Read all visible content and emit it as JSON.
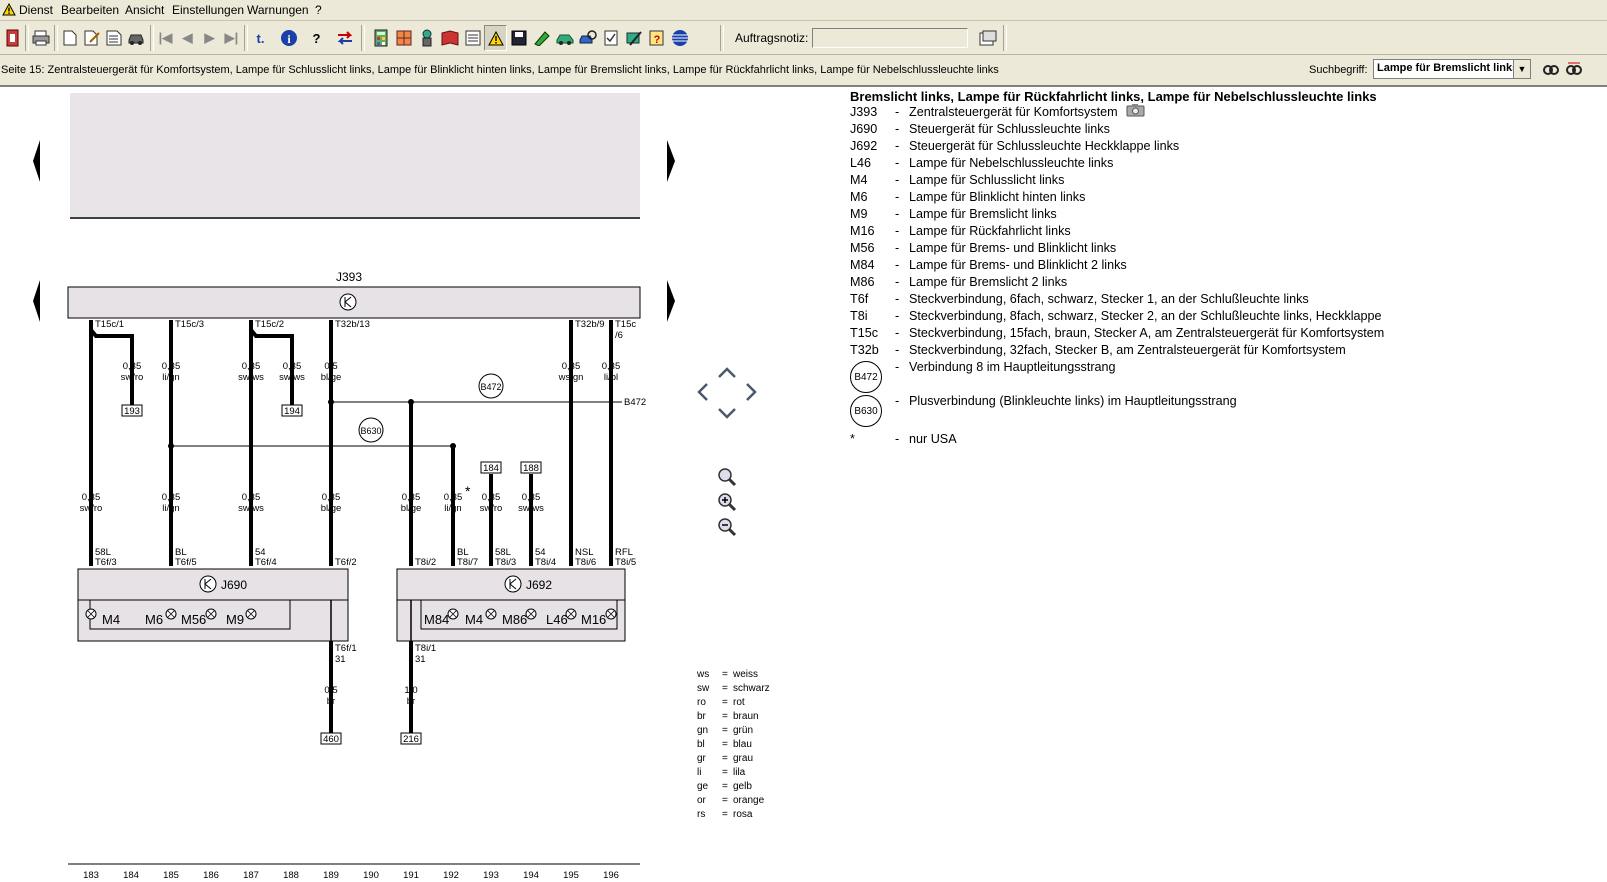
{
  "menu": {
    "items": [
      "Dienst",
      "Bearbeiten",
      "Ansicht",
      "Einstellungen",
      "Warnungen",
      "?"
    ]
  },
  "toolbar": {
    "auftragsnotiz_label": "Auftragsnotiz:",
    "auftragsnotiz_value": ""
  },
  "statusbar": {
    "page_text": "Seite 15: Zentralsteuergerät für Komfortsystem, Lampe für Schlusslicht links, Lampe für Blinklicht hinten links, Lampe für Bremslicht links, Lampe für Rückfahrlicht links, Lampe für Nebelschlussleuchte links",
    "search_label": "Suchbegriff:",
    "search_value": "Lampe für Bremslicht links"
  },
  "legend": {
    "heading": "Bremslicht links, Lampe für Rückfahrlicht links, Lampe für Nebelschlussleuchte links",
    "items": [
      {
        "code": "J393",
        "desc": "Zentralsteuergerät für Komfortsystem"
      },
      {
        "code": "J690",
        "desc": "Steuergerät für Schlussleuchte links"
      },
      {
        "code": "J692",
        "desc": "Steuergerät für Schlussleuchte Heckklappe links"
      },
      {
        "code": "L46",
        "desc": "Lampe für Nebelschlussleuchte links"
      },
      {
        "code": "M4",
        "desc": "Lampe für Schlusslicht links"
      },
      {
        "code": "M6",
        "desc": "Lampe für Blinklicht hinten links"
      },
      {
        "code": "M9",
        "desc": "Lampe für Bremslicht links"
      },
      {
        "code": "M16",
        "desc": "Lampe für Rückfahrlicht links"
      },
      {
        "code": "M56",
        "desc": "Lampe für Brems- und Blinklicht links"
      },
      {
        "code": "M84",
        "desc": "Lampe für Brems- und Blinklicht 2 links"
      },
      {
        "code": "M86",
        "desc": "Lampe für Bremslicht 2 links"
      },
      {
        "code": "T6f",
        "desc": "Steckverbindung, 6fach, schwarz, Stecker 1, an der Schlußleuchte links"
      },
      {
        "code": "T8i",
        "desc": "Steckverbindung, 8fach, schwarz, Stecker 2, an der Schlußleuchte links, Heckklappe"
      },
      {
        "code": "T15c",
        "desc": "Steckverbindung, 15fach, braun, Stecker A, am Zentralsteuergerät für Komfortsystem"
      },
      {
        "code": "T32b",
        "desc": "Steckverbindung, 32fach, Stecker B, am Zentralsteuergerät für Komfortsystem"
      }
    ],
    "circles": [
      {
        "code": "B472",
        "desc": "Verbindung 8 im Hauptleitungsstrang"
      },
      {
        "code": "B630",
        "desc": "Plusverbindung (Blinkleuchte links) im Hauptleitungsstrang"
      }
    ],
    "footnote": {
      "code": "*",
      "desc": "nur USA"
    }
  },
  "diagram": {
    "unit_top": "J393",
    "unit_left": "J690",
    "unit_right": "J692",
    "top_pins": [
      "T15c/1",
      "T15c/3",
      "T15c/2",
      "T32b/13",
      "T32b/9",
      "T15c",
      "/6"
    ],
    "lamps_left": [
      "M4",
      "M6",
      "M56",
      "M9"
    ],
    "lamps_right": [
      "M84",
      "M4",
      "M86",
      "L46",
      "M16"
    ],
    "wires": {
      "w1": [
        "0,35",
        "sw/ro"
      ],
      "w2": [
        "0,35",
        "sw/ro"
      ],
      "w3": [
        "0,35",
        "li/gn"
      ],
      "w4": [
        "0,35",
        "li/gn"
      ],
      "w5": [
        "0,35",
        "sw/ws"
      ],
      "w6": [
        "0,35",
        "sw/ws"
      ],
      "w7": [
        "0,5",
        "bl/ge"
      ],
      "w8": [
        "0,35",
        "bl/ge"
      ],
      "w9": [
        "0,35",
        "ws/gn"
      ],
      "w10": [
        "0,35",
        "li/bl"
      ],
      "w11": [
        "0,35",
        "bl/ge"
      ],
      "w12": [
        "0,35",
        "li/gn"
      ],
      "w13": [
        "0,35",
        "sw/ro"
      ],
      "w14": [
        "0,35",
        "sw/ws"
      ],
      "w15": [
        "0,5",
        "br"
      ],
      "w16": [
        "1,0",
        "br"
      ]
    },
    "pins_bottom_left": [
      [
        "58L",
        "T6f/3"
      ],
      [
        "BL",
        "T6f/5"
      ],
      [
        "54",
        "T6f/4"
      ],
      [
        "",
        "T6f/2"
      ]
    ],
    "pins_bottom_right": [
      [
        "",
        "T8i/2"
      ],
      [
        "BL",
        "T8i/7"
      ],
      [
        "58L",
        "T8i/3"
      ],
      [
        "54",
        "T8i/4"
      ],
      [
        "NSL",
        "T8i/6"
      ],
      [
        "RFL",
        "T8i/5"
      ]
    ],
    "ground_left": [
      "T6f/1",
      "31"
    ],
    "ground_right": [
      "T8i/1",
      "31"
    ],
    "refs": [
      "193",
      "194",
      "184",
      "188",
      "460",
      "216"
    ],
    "splice_b472": "B472",
    "splice_b630": "B630",
    "b472_line_label": "B472",
    "asterisk": "*",
    "track_numbers": [
      "183",
      "184",
      "185",
      "186",
      "187",
      "188",
      "189",
      "190",
      "191",
      "192",
      "193",
      "194",
      "195",
      "196"
    ],
    "color_codes": [
      [
        "ws",
        "weiss"
      ],
      [
        "sw",
        "schwarz"
      ],
      [
        "ro",
        "rot"
      ],
      [
        "br",
        "braun"
      ],
      [
        "gn",
        "grün"
      ],
      [
        "bl",
        "blau"
      ],
      [
        "gr",
        "grau"
      ],
      [
        "li",
        "lila"
      ],
      [
        "ge",
        "gelb"
      ],
      [
        "or",
        "orange"
      ],
      [
        "rs",
        "rosa"
      ]
    ]
  }
}
